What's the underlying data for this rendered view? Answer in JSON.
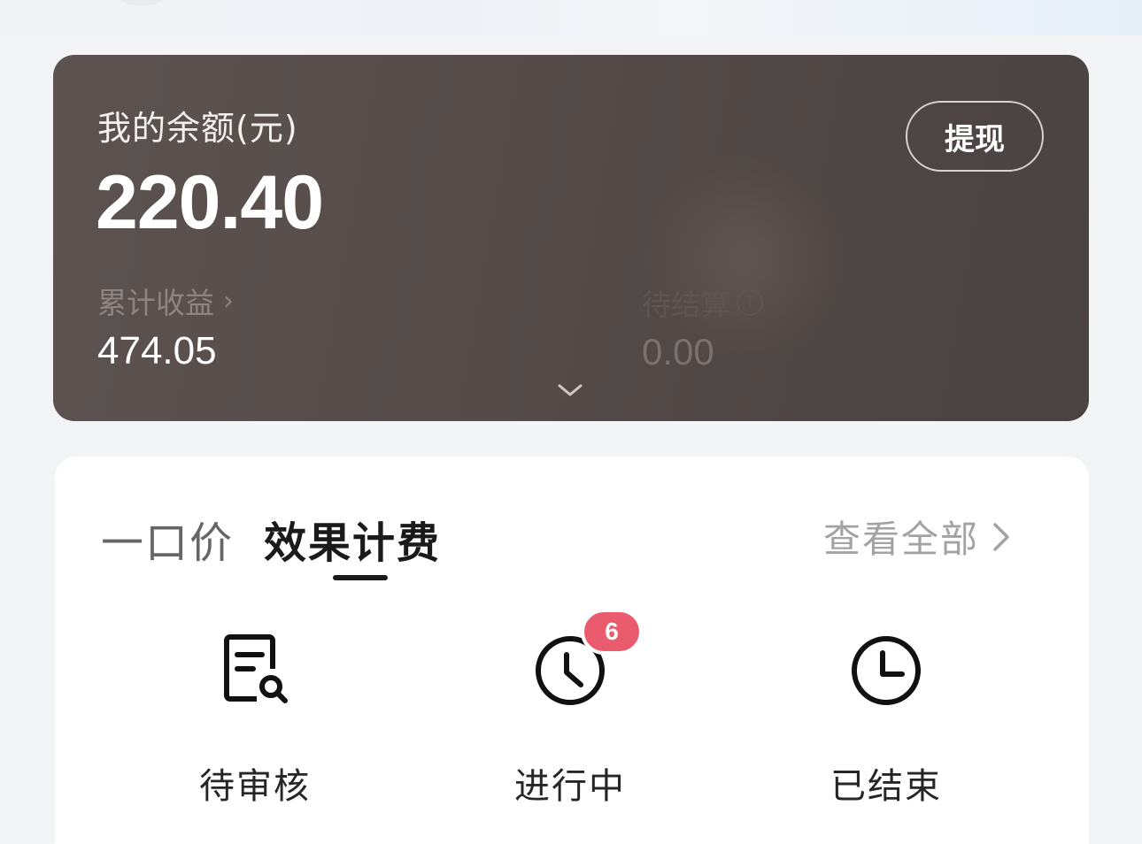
{
  "balance": {
    "title": "我的余额(元)",
    "amount": "220.40",
    "withdraw_label": "提现",
    "cumulative_label": "累计收益",
    "cumulative_value": "474.05",
    "pending_label": "待结算",
    "pending_value": "0.00"
  },
  "orders": {
    "tabs": [
      {
        "label": "一口价",
        "active": false
      },
      {
        "label": "效果计费",
        "active": true
      }
    ],
    "view_all_label": "查看全部",
    "statuses": [
      {
        "label": "待审核",
        "icon": "document-search-icon"
      },
      {
        "label": "进行中",
        "icon": "clock-icon",
        "badge": "6"
      },
      {
        "label": "已结束",
        "icon": "clock-icon"
      }
    ]
  },
  "colors": {
    "card_dark": "#554c4a",
    "badge": "#ea5b6e",
    "text_dark": "#1a1a1a",
    "text_muted": "#a3a3a3"
  }
}
